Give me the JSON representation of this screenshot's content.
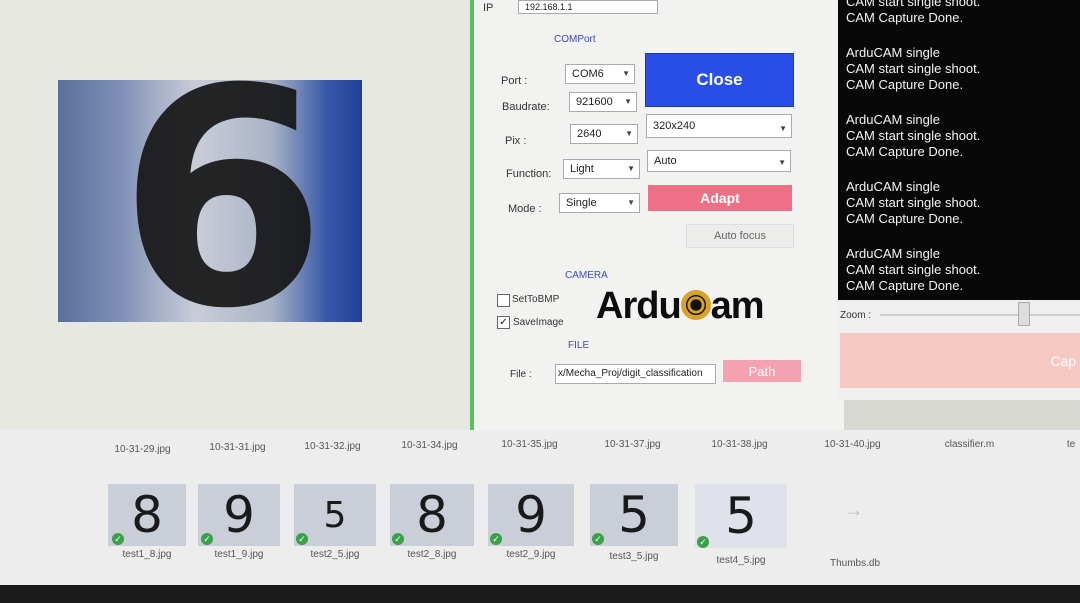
{
  "preview": {
    "digit": "6"
  },
  "dialog": {
    "ip_label": "IP",
    "ip_value": "192.168.1.1",
    "comport_section": "COMPort",
    "port_label": "Port   :",
    "port_value": "COM6",
    "baud_label": "Baudrate:",
    "baud_value": "921600",
    "pix_label": "Pix    :",
    "pix_value": "2640",
    "resolution_value": "320x240",
    "function_label": "Function:",
    "function_value": "Light",
    "function_mode_value": "Auto",
    "mode_label": "Mode   :",
    "mode_value": "Single",
    "close_label": "Close",
    "adapt_label": "Adapt",
    "autofocus_label": "Auto focus",
    "camera_section": "CAMERA",
    "set_to_bmp_label": "SetToBMP",
    "set_to_bmp_checked": false,
    "save_image_label": "SaveImage",
    "save_image_checked": true,
    "logo_text_left": "Ardu",
    "logo_text_right": "am",
    "file_section": "FILE",
    "file_label": "File :",
    "file_value": "x/Mecha_Proj/digit_classification",
    "path_label": "Path"
  },
  "log": {
    "lines": [
      "CAM start single shoot.",
      "CAM Capture Done.",
      "",
      "ArduCAM single",
      "CAM start single shoot.",
      "CAM Capture Done.",
      "",
      "ArduCAM single",
      "CAM start single shoot.",
      "CAM Capture Done.",
      "",
      "ArduCAM single",
      "CAM start single shoot.",
      "CAM Capture Done.",
      "",
      "ArduCAM single",
      "CAM start single shoot.",
      "CAM Capture Done."
    ]
  },
  "right": {
    "zoom_label": "Zoom :",
    "capture_label": "Cap"
  },
  "explorer": {
    "top_files": [
      "10-31-29.jpg",
      "10-31-31.jpg",
      "10-31-32.jpg",
      "10-31-34.jpg",
      "10-31-35.jpg",
      "10-31-37.jpg",
      "10-31-38.jpg",
      "10-31-40.jpg",
      "classifier.m",
      "te"
    ],
    "thumbs": [
      {
        "name": "test1_8.jpg",
        "digit": "8"
      },
      {
        "name": "test1_9.jpg",
        "digit": "9"
      },
      {
        "name": "test2_5.jpg",
        "digit": "5"
      },
      {
        "name": "test2_8.jpg",
        "digit": "8"
      },
      {
        "name": "test2_9.jpg",
        "digit": "9"
      },
      {
        "name": "test3_5.jpg",
        "digit": "5"
      },
      {
        "name": "test4_5.jpg",
        "digit": "5"
      }
    ],
    "thumbs_db": "Thumbs.db"
  },
  "colors": {
    "accent_green": "#59c35b",
    "close_blue": "#2a4fe6",
    "adapt_pink": "#ee7086",
    "check_green": "#3aa04a"
  }
}
